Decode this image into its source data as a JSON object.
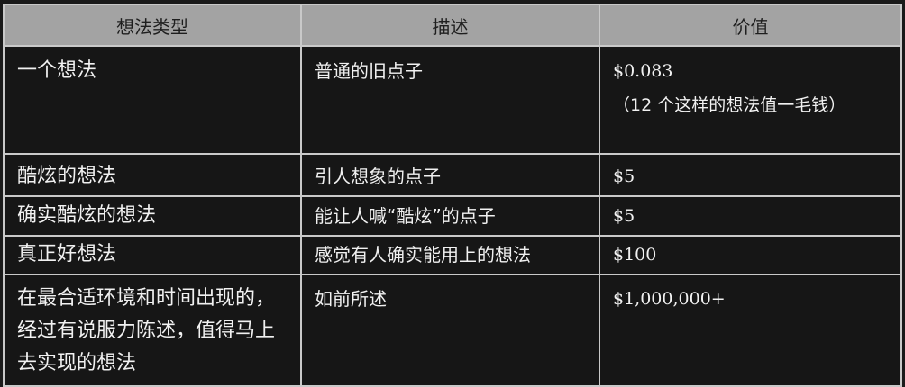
{
  "table": {
    "headers": [
      "想法类型",
      "描述",
      "价值"
    ],
    "rows": [
      {
        "type": "一个想法",
        "description": "普通的旧点子",
        "value": "$0.083",
        "note": "（12 个这样的想法值一毛钱）"
      },
      {
        "type": "酷炫的想法",
        "description": "引人想象的点子",
        "value": "$5"
      },
      {
        "type": "确实酷炫的想法",
        "description": "能让人喊“酷炫”的点子",
        "value": "$5"
      },
      {
        "type": "真正好想法",
        "description": "感觉有人确实能用上的想法",
        "value": "$100"
      },
      {
        "type": "在最合适环境和时间出现的，经过有说服力陈述，值得马上去实现的想法",
        "description": "如前所述",
        "value": "$1,000,000+"
      }
    ]
  }
}
